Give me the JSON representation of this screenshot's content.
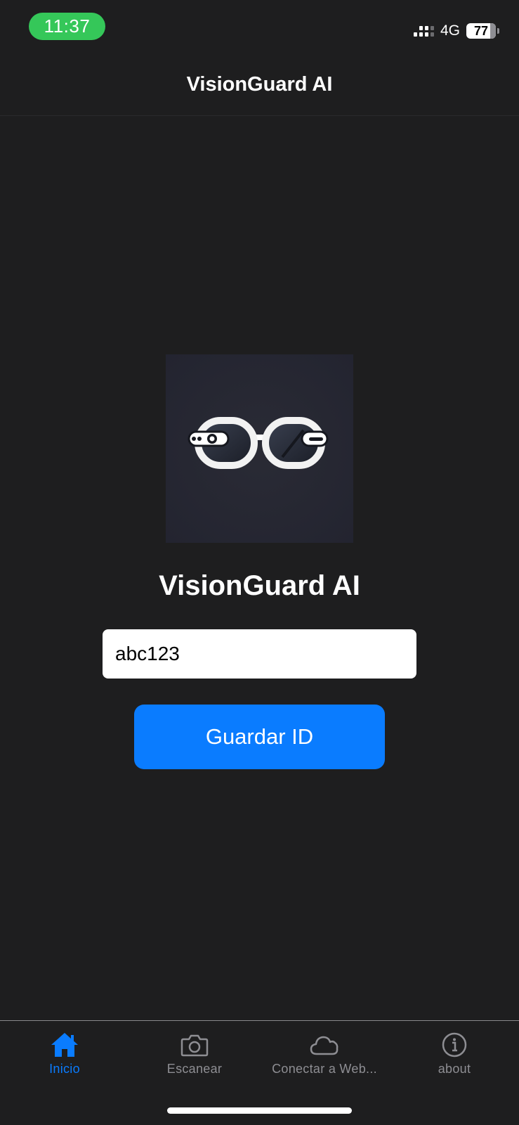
{
  "status_bar": {
    "time": "11:37",
    "network": "4G",
    "battery": "77"
  },
  "nav": {
    "title": "VisionGuard AI"
  },
  "main": {
    "app_name": "VisionGuard AI",
    "id_input": {
      "value": "abc123",
      "placeholder": ""
    },
    "save_button_label": "Guardar ID"
  },
  "tabs": [
    {
      "label": "Inicio",
      "icon": "home-icon",
      "active": true
    },
    {
      "label": "Escanear",
      "icon": "camera-icon",
      "active": false
    },
    {
      "label": "Conectar a Web...",
      "icon": "cloud-icon",
      "active": false
    },
    {
      "label": "about",
      "icon": "info-icon",
      "active": false
    }
  ],
  "colors": {
    "background": "#1e1e1f",
    "accent": "#0a7cff",
    "time_pill": "#35c759",
    "inactive_tab": "#8e8e93"
  }
}
